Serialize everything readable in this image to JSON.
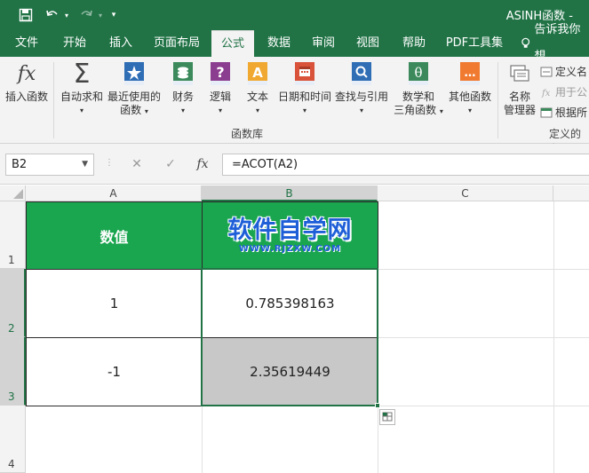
{
  "window": {
    "title": "ASINH函数 -"
  },
  "quick_access": {
    "save_icon": "save-icon",
    "undo_icon": "undo-icon",
    "redo_icon": "redo-icon",
    "customize_icon": "customize-qat-icon"
  },
  "tabs": [
    {
      "label": "文件"
    },
    {
      "label": "开始"
    },
    {
      "label": "插入"
    },
    {
      "label": "页面布局"
    },
    {
      "label": "公式",
      "active": true
    },
    {
      "label": "数据"
    },
    {
      "label": "审阅"
    },
    {
      "label": "视图"
    },
    {
      "label": "帮助"
    },
    {
      "label": "PDF工具集"
    }
  ],
  "tell_me": {
    "icon": "lightbulb-icon",
    "label": "告诉我你想"
  },
  "ribbon": {
    "buttons": [
      {
        "line1": "插入函数",
        "line2": "",
        "icon": "fx-icon"
      },
      {
        "line1": "自动求和",
        "line2": "",
        "icon": "sigma-icon",
        "dropdown": true
      },
      {
        "line1": "最近使用的",
        "line2": "函数",
        "icon": "star-book-icon",
        "dropdown": true
      },
      {
        "line1": "财务",
        "line2": "",
        "icon": "finance-book-icon",
        "dropdown": true
      },
      {
        "line1": "逻辑",
        "line2": "",
        "icon": "logic-book-icon",
        "dropdown": true
      },
      {
        "line1": "文本",
        "line2": "",
        "icon": "text-book-icon",
        "dropdown": true
      },
      {
        "line1": "日期和时间",
        "line2": "",
        "icon": "calendar-book-icon",
        "dropdown": true
      },
      {
        "line1": "查找与引用",
        "line2": "",
        "icon": "lookup-book-icon",
        "dropdown": true
      },
      {
        "line1": "数学和",
        "line2": "三角函数",
        "icon": "math-book-icon",
        "dropdown": true
      },
      {
        "line1": "其他函数",
        "line2": "",
        "icon": "more-book-icon",
        "dropdown": true
      }
    ],
    "group_label": "函数库",
    "name_manager": {
      "line1": "名称",
      "line2": "管理器",
      "icon": "name-manager-icon"
    },
    "side_items": [
      {
        "label": "定义名",
        "icon": "define-name-icon",
        "enabled": true
      },
      {
        "label": "用于公",
        "icon": "use-in-formula-icon",
        "enabled": false
      },
      {
        "label": "根据所",
        "icon": "create-from-selection-icon",
        "enabled": true
      }
    ],
    "defined_names_label": "定义的名"
  },
  "formula_bar": {
    "name_box": "B2",
    "cancel_icon": "✕",
    "enter_icon": "✓",
    "fx": "fx",
    "formula": "=ACOT(A2)"
  },
  "grid": {
    "columns": [
      "A",
      "B",
      "C"
    ],
    "rows": [
      "1",
      "2",
      "3",
      "4"
    ],
    "cells": {
      "A1": "数值",
      "A2": "1",
      "B2": "0.785398163",
      "A3": "-1",
      "B3": "2.35619449"
    },
    "watermark": {
      "main": "软件自学网",
      "sub": "WWW.RJZXW.COM"
    }
  },
  "colors": {
    "excel_green": "#217346",
    "header_fill": "#1aa54f",
    "selected_fill": "#c8c8c8",
    "watermark_blue": "#1e5fd8"
  }
}
